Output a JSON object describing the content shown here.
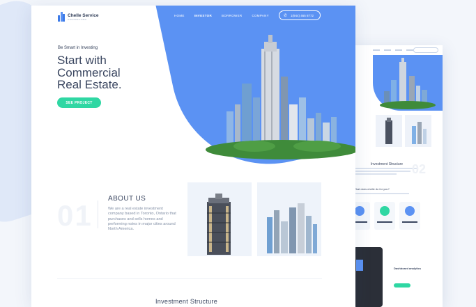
{
  "brand": {
    "name": "Chelle Service",
    "sub": "CONTRACTING"
  },
  "nav": {
    "items": [
      "HOME",
      "INVESTOR",
      "BORROWER",
      "COMPANY"
    ],
    "active_index": 1
  },
  "phone": {
    "number": "1(944) 465 8772"
  },
  "hero": {
    "tagline": "Be Smart in Investing",
    "headline_line1": "Start with",
    "headline_line2": "Commercial",
    "headline_line3": "Real Estate.",
    "cta": "SEE PROJECT"
  },
  "about": {
    "number": "01",
    "title": "ABOUT US",
    "text": "We are a real estate investment company based in Toronto, Ontario that purchases and sells homes and performing notes in major cities around North America."
  },
  "section2": {
    "title": "Investment Structure"
  },
  "back_page": {
    "title": "Investment Structure",
    "number": "02",
    "question": "What does chelle do for you?",
    "analytics": "Dashboard analytics"
  },
  "colors": {
    "accent": "#5b92f3",
    "cta": "#2fd7a3",
    "text": "#3a4660"
  }
}
